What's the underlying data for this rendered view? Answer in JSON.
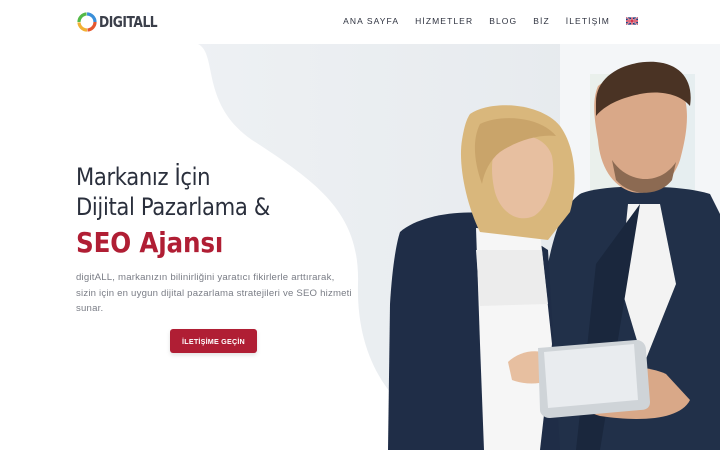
{
  "brand": {
    "logo_text": "DIGITALL",
    "accent": "#b01e34"
  },
  "nav": {
    "items": [
      {
        "label": "ANA SAYFA"
      },
      {
        "label": "HİZMETLER"
      },
      {
        "label": "BLOG"
      },
      {
        "label": "BİZ"
      },
      {
        "label": "İLETİŞİM"
      }
    ],
    "language_icon": "uk-flag-icon"
  },
  "hero": {
    "title_line1": "Markanız İçin",
    "title_line2": "Dijital Pazarlama &",
    "title_highlight": "SEO Ajansı",
    "description": "digitALL, markanızın bilinirliğini yaratıcı fikirlerle arttırarak, sizin için en uygun dijital pazarlama stratejileri ve SEO hizmeti sunar.",
    "cta_label": "İLETİŞİME GEÇİN"
  }
}
